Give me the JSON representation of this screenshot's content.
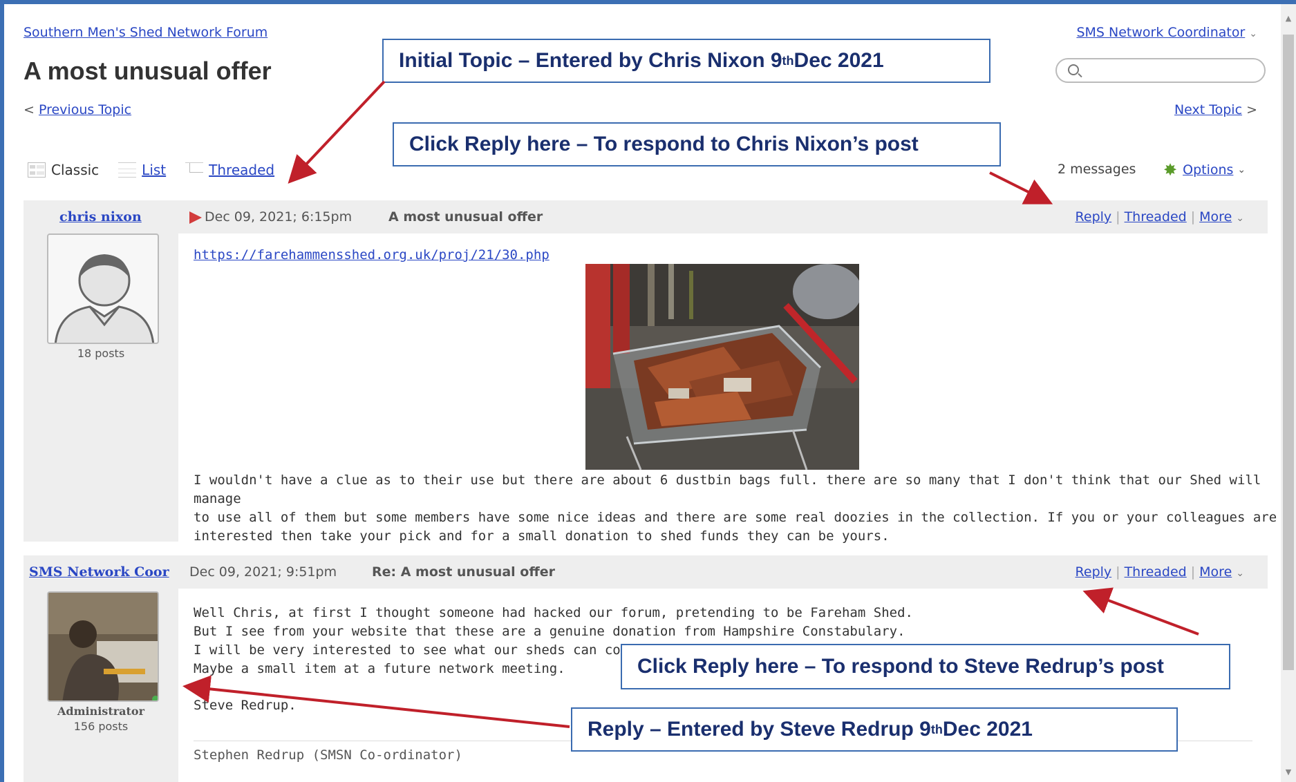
{
  "forum": {
    "breadcrumb": "Southern Men's Shed Network Forum",
    "topic_title": "A most unusual offer",
    "user_menu": "SMS Network Coordinator",
    "search_placeholder": "",
    "prev_topic": "Previous Topic",
    "next_topic": "Next Topic",
    "prev_arrow": "<",
    "next_arrow": ">",
    "chevron": "⌄"
  },
  "views": {
    "classic": "Classic",
    "list": "List",
    "threaded": "Threaded",
    "message_count": "2 messages",
    "options": "Options"
  },
  "posts": [
    {
      "author": "chris nixon",
      "date": "Dec 09, 2021; 6:15pm",
      "subject": "A most unusual offer",
      "posts_count": "18 posts",
      "url": "https://farehammensshed.org.uk/proj/21/30.php",
      "body": [
        "I wouldn't have a clue as to their use but there are about 6 dustbin bags full. there are so many that I don't think that our Shed will manage",
        "to use all of them but some members have some nice ideas and there are some real doozies in the collection. If you or your colleagues are",
        "interested then take your pick and for a small donation to shed funds they can be yours."
      ],
      "actions": {
        "reply": "Reply",
        "threaded": "Threaded",
        "more": "More",
        "sep": "|"
      }
    },
    {
      "author": "SMS Network Coor",
      "date": "Dec 09, 2021; 9:51pm",
      "subject": "Re: A most unusual offer",
      "role": "Administrator",
      "posts_count": "156 posts",
      "body": [
        "Well Chris, at first I thought someone had hacked our forum, pretending to be Fareham Shed.",
        "But I see from your website that these are a genuine donation from Hampshire Constabulary.",
        "I will be very interested to see what our sheds can come u",
        "Maybe a small item at a future network meeting."
      ],
      "signoff": "Steve Redrup.",
      "signature": "Stephen Redrup (SMSN Co-ordinator)",
      "actions": {
        "reply": "Reply",
        "threaded": "Threaded",
        "more": "More",
        "sep": "|"
      }
    }
  ],
  "callouts": {
    "initial_topic": {
      "pre": "Initial Topic – Entered by Chris Nixon 9",
      "sup": "th",
      "post": " Dec 2021"
    },
    "reply_chris": "Click Reply here – To respond to Chris Nixon’s post",
    "reply_steve": "Click Reply here – To respond to Steve Redrup’s post",
    "reply_entered": {
      "pre": "Reply – Entered by Steve Redrup 9",
      "sup": "th",
      "post": " Dec 2021"
    }
  },
  "colors": {
    "link": "#2a47c4",
    "callout_border": "#3a6bb0",
    "callout_text": "#1a2f6e",
    "annotation_arrow": "#c0202a",
    "post_header_bg": "#eeeeee",
    "online_dot": "#4caf50"
  }
}
